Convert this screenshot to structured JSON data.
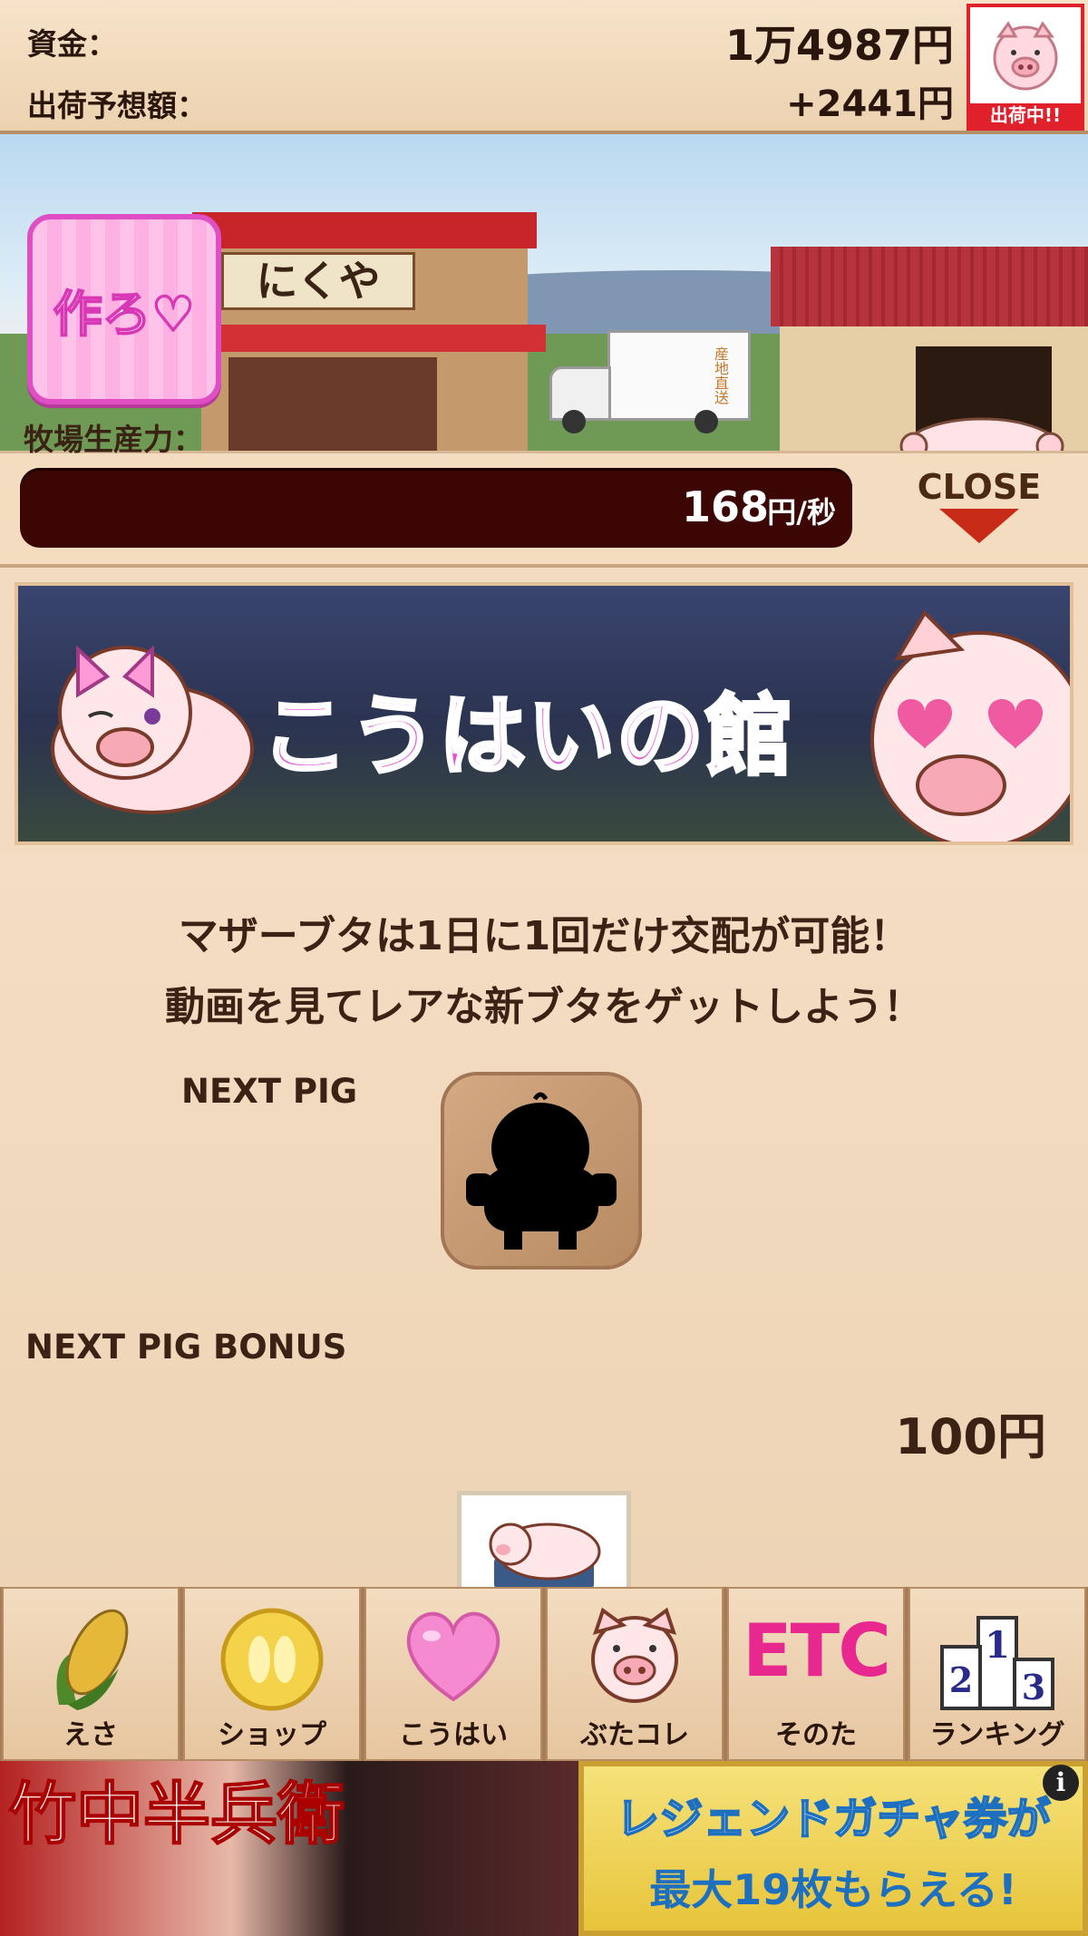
{
  "header": {
    "funds_label": "資金：",
    "funds_value": "1万4987円",
    "forecast_label": "出荷予想額：",
    "forecast_value": "+2441円",
    "ship_status": "出荷中!!"
  },
  "scene": {
    "make_button": "作ろ♡",
    "shop_sign": "にくや",
    "truck_text": "産地直送"
  },
  "production": {
    "label": "牧場生産力：",
    "value": "168",
    "unit": "円/秒",
    "close_label": "CLOSE"
  },
  "banner": {
    "title": "こうはいの館"
  },
  "content": {
    "line1": "マザーブタは1日に1回だけ交配が可能！",
    "line2": "動画を見てレアな新ブタをゲットしよう！",
    "next_pig_label": "NEXT PIG",
    "next_pig_bonus_label": "NEXT PIG BONUS",
    "next_pig_bonus_value": "100円"
  },
  "nav": [
    {
      "label": "えさ",
      "icon": "corn-icon"
    },
    {
      "label": "ショップ",
      "icon": "coin-icon"
    },
    {
      "label": "こうはい",
      "icon": "heart-icon"
    },
    {
      "label": "ぶたコレ",
      "icon": "pig-face-icon"
    },
    {
      "label": "そのた",
      "icon": "etc-icon",
      "icon_text": "ETC"
    },
    {
      "label": "ランキング",
      "icon": "podium-icon"
    }
  ],
  "ad": {
    "left_text": "竹中半兵衛",
    "right_line1": "レジェンドガチャ券が",
    "right_line2": "最大19枚もらえる!",
    "info": "i"
  },
  "colors": {
    "accent_pink": "#e64fd6",
    "close_red": "#c82a18",
    "bar_dark": "#3b0604",
    "ship_red": "#e0202a"
  }
}
